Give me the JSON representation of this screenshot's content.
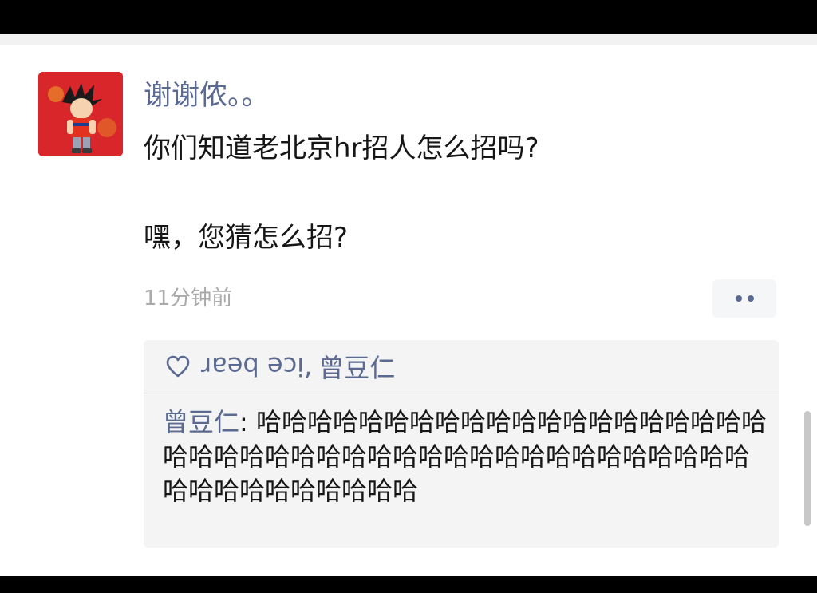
{
  "post": {
    "username": "谢谢侬。。",
    "text": "你们知道老北京hr招人怎么招吗?\n\n嘿，您猜怎么招?",
    "timestamp": "11分钟前",
    "more_icon": "more-dots-icon"
  },
  "likes": {
    "icon": "heart-icon",
    "users": [
      "ice bear",
      "曾豆仁"
    ],
    "separator": ","
  },
  "comment": {
    "author": "曾豆仁",
    "separator": ": ",
    "text": "哈哈哈哈哈哈哈哈哈哈哈哈哈哈哈哈哈哈哈哈哈哈哈哈哈哈哈哈哈哈哈哈哈哈哈哈哈哈哈哈哈哈哈哈哈哈哈哈哈哈哈哈哈"
  },
  "colors": {
    "name": "#5b6a92",
    "text": "#161616",
    "muted": "#a9a9a9",
    "avatar_bg": "#d8262a"
  }
}
